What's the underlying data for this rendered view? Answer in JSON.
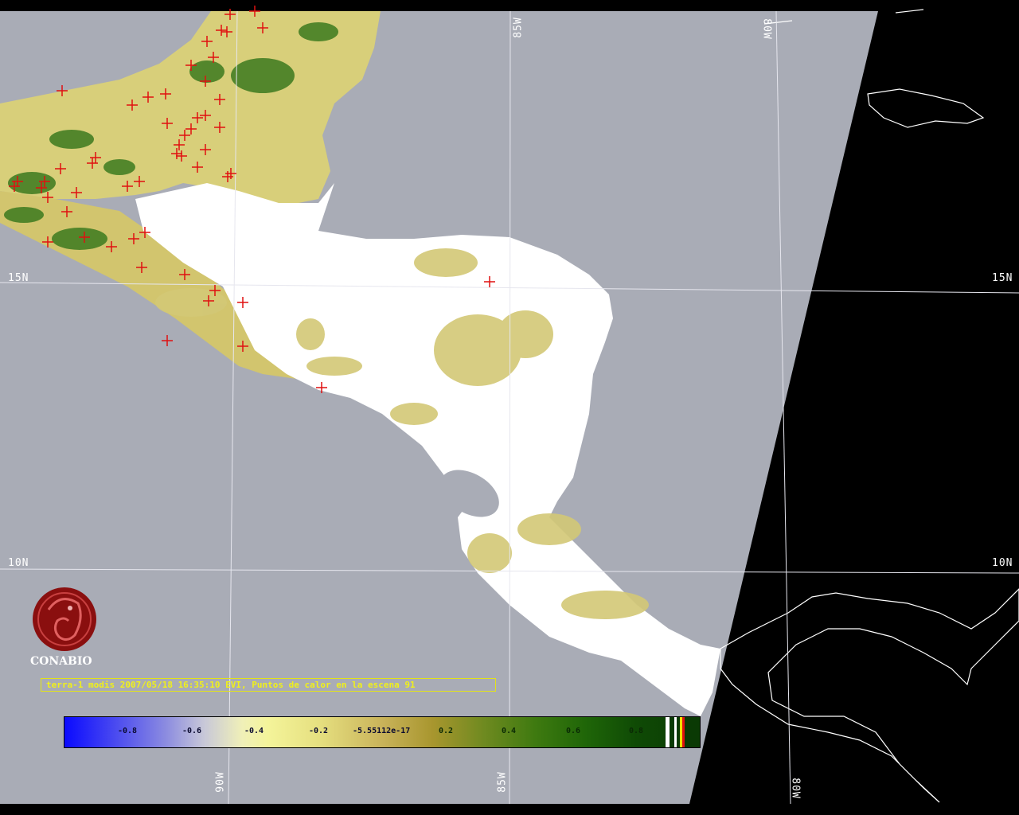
{
  "map": {
    "lat_labels": {
      "n15_left": "15N",
      "n15_right": "15N",
      "n10_left": "10N",
      "n10_right": "10N"
    },
    "lon_labels": {
      "w85_top": "85W",
      "w80_top": "80W",
      "w90_bottom": "90W",
      "w85_bottom": "85W",
      "w80_bottom": "80W"
    },
    "colors": {
      "ocean": "#a9acb6",
      "land_cloud": "#ffffff",
      "vegetation_light": "#d8cf7a",
      "vegetation_dark": "#3c7a1f",
      "hotspot": "#e01010",
      "no_data": "#000000"
    },
    "hotspot_marker": "red-cross-icon"
  },
  "logo": {
    "text": "CONABIO",
    "icon": "conabio-macaw-logo-icon"
  },
  "caption": {
    "text": "terra-1 modis 2007/05/18 16:35:10 EVI, Puntos de calor en la escena 91"
  },
  "colorbar": {
    "ticks": [
      "-0.8",
      "-0.6",
      "-0.4",
      "-0.2",
      "-5.55112e-17",
      "0.2",
      "0.4",
      "0.6",
      "0.8"
    ]
  }
}
